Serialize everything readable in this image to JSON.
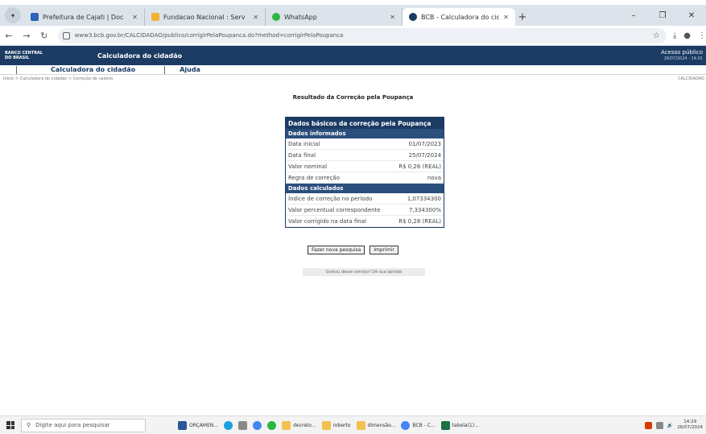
{
  "browser": {
    "tabs": [
      {
        "title": "Prefeitura de Cajati | Doc",
        "color": "#2a63b8",
        "active": false
      },
      {
        "title": "Fundacao Nacional : Serv",
        "color": "#f2b134",
        "active": false
      },
      {
        "title": "WhatsApp",
        "color": "#2cb742",
        "active": false
      },
      {
        "title": "BCB - Calculadora do cidadão",
        "color": "#1b3b63",
        "active": true
      }
    ],
    "url": "www3.bcb.gov.br/CALCIDADAO/publico/corrigirPelaPoupanca.do?method=corrigirPelaPoupanca",
    "win": {
      "minimize": "–",
      "restore": "❐",
      "close": "✕"
    }
  },
  "site": {
    "logo_line1": "BANCO CENTRAL",
    "logo_line2": "DO BRASIL",
    "app_title": "Calculadora do cidadão",
    "public_access": "Acesso público",
    "datetime": "26/07/2024 - 14:01",
    "menu": [
      "Calculadora do cidadão",
      "Ajuda"
    ],
    "breadcrumb": "Início > Calculadora do cidadão > Correção de valores",
    "crumb_right": "CALCIDADAO"
  },
  "result": {
    "title": "Resultado da Correção pela Poupança",
    "header": "Dados básicos da correção pela Poupança",
    "section1": "Dados informados",
    "informed": [
      {
        "label": "Data inicial",
        "value": "01/07/2023"
      },
      {
        "label": "Data final",
        "value": "25/07/2024"
      },
      {
        "label": "Valor nominal",
        "value": "R$ 0,26 (REAL)"
      },
      {
        "label": "Regra de correção",
        "value": "nova"
      }
    ],
    "section2": "Dados calculados",
    "calculated": [
      {
        "label": "Índice de correção no período",
        "value": "1,07334300"
      },
      {
        "label": "Valor percentual correspondente",
        "value": "7,334300%"
      },
      {
        "label": "Valor corrigido na data final",
        "value": "R$ 0,28 (REAL)"
      }
    ],
    "btn_new": "Fazer nova pesquisa",
    "btn_print": "Imprimir",
    "feedback": "Gostou desse serviço? Dê sua opinião"
  },
  "taskbar": {
    "search_placeholder": "Digite aqui para pesquisar",
    "items": [
      {
        "label": "ORÇAMEN...",
        "color": "#2b579a"
      },
      {
        "label": "",
        "color": "#1ba1e2"
      },
      {
        "label": "",
        "color": "#e0e0e0"
      },
      {
        "label": "",
        "color": "#4285f4"
      },
      {
        "label": "",
        "color": "#2cb742"
      },
      {
        "label": "decreto...",
        "color": "#f2c14e"
      },
      {
        "label": "roberto",
        "color": "#f2c14e"
      },
      {
        "label": "dimensão...",
        "color": "#f2c14e"
      },
      {
        "label": "BCB - C...",
        "color": "#4285f4"
      },
      {
        "label": "tabela(1)...",
        "color": "#1d6f42"
      }
    ],
    "time": "14:29",
    "date": "26/07/2024"
  }
}
